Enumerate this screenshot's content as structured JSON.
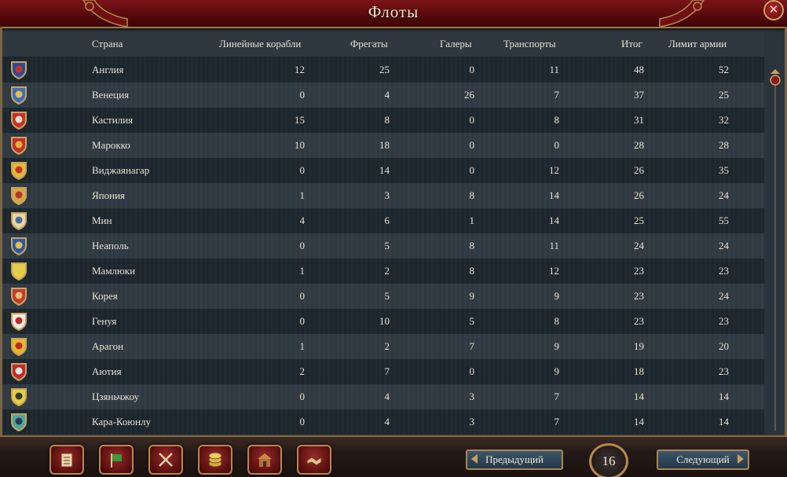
{
  "window": {
    "title": "Флоты",
    "close_icon": "✕"
  },
  "columns": {
    "country": "Страна",
    "ships_of_line": "Линейные корабли",
    "frigates": "Фрегаты",
    "galleys": "Галеры",
    "transports": "Транспорты",
    "total": "Итог",
    "army_limit": "Лимит армии"
  },
  "rows": [
    {
      "country": "Англия",
      "ships": "12",
      "frigates": "25",
      "galleys": "0",
      "transports": "11",
      "total": "48",
      "limit": "52",
      "flag": {
        "field": "#2a4b9a",
        "charge": "#c8302a",
        "accent": "#e6c04a"
      }
    },
    {
      "country": "Венеция",
      "ships": "0",
      "frigates": "4",
      "galleys": "26",
      "transports": "7",
      "total": "37",
      "limit": "25",
      "flag": {
        "field": "#3c6ec0",
        "charge": "#e5c04a",
        "accent": "#e5c04a"
      }
    },
    {
      "country": "Кастилия",
      "ships": "15",
      "frigates": "8",
      "galleys": "0",
      "transports": "8",
      "total": "31",
      "limit": "32",
      "flag": {
        "field": "#c8302a",
        "charge": "#e8e0d0",
        "accent": "#c8302a"
      }
    },
    {
      "country": "Марокко",
      "ships": "10",
      "frigates": "18",
      "galleys": "0",
      "transports": "0",
      "total": "28",
      "limit": "28",
      "flag": {
        "field": "#c0302a",
        "charge": "#e6b040",
        "accent": "#c0302a"
      }
    },
    {
      "country": "Виджаянагар",
      "ships": "0",
      "frigates": "14",
      "galleys": "0",
      "transports": "12",
      "total": "26",
      "limit": "35",
      "flag": {
        "field": "#e2b838",
        "charge": "#c83028",
        "accent": "#e2b838"
      }
    },
    {
      "country": "Япония",
      "ships": "1",
      "frigates": "3",
      "galleys": "8",
      "transports": "14",
      "total": "26",
      "limit": "24",
      "flag": {
        "field": "#d8a648",
        "charge": "#b5352a",
        "accent": "#d8a648"
      }
    },
    {
      "country": "Мин",
      "ships": "4",
      "frigates": "6",
      "galleys": "1",
      "transports": "14",
      "total": "25",
      "limit": "55",
      "flag": {
        "field": "#e6d8a8",
        "charge": "#4a6c9a",
        "accent": "#e6d8a8"
      }
    },
    {
      "country": "Неаполь",
      "ships": "0",
      "frigates": "5",
      "galleys": "8",
      "transports": "11",
      "total": "24",
      "limit": "24",
      "flag": {
        "field": "#2d58a8",
        "charge": "#e2c050",
        "accent": "#2d58a8"
      }
    },
    {
      "country": "Мамлюки",
      "ships": "1",
      "frigates": "2",
      "galleys": "8",
      "transports": "12",
      "total": "23",
      "limit": "23",
      "flag": {
        "field": "#e3cc48",
        "charge": "#e3cc48",
        "accent": "#e3cc48"
      }
    },
    {
      "country": "Корея",
      "ships": "0",
      "frigates": "5",
      "galleys": "9",
      "transports": "9",
      "total": "23",
      "limit": "24",
      "flag": {
        "field": "#c23a30",
        "charge": "#e0c070",
        "accent": "#c23a30"
      }
    },
    {
      "country": "Генуя",
      "ships": "0",
      "frigates": "10",
      "galleys": "5",
      "transports": "8",
      "total": "23",
      "limit": "23",
      "flag": {
        "field": "#ecebe6",
        "charge": "#c42a26",
        "accent": "#ecebe6"
      }
    },
    {
      "country": "Арагон",
      "ships": "1",
      "frigates": "2",
      "galleys": "7",
      "transports": "9",
      "total": "19",
      "limit": "20",
      "flag": {
        "field": "#e8b828",
        "charge": "#c0282a",
        "accent": "#e8b828"
      }
    },
    {
      "country": "Аютия",
      "ships": "2",
      "frigates": "7",
      "galleys": "0",
      "transports": "9",
      "total": "18",
      "limit": "23",
      "flag": {
        "field": "#c02a30",
        "charge": "#eee8e0",
        "accent": "#c02a30"
      }
    },
    {
      "country": "Цзяньчжоу",
      "ships": "0",
      "frigates": "4",
      "galleys": "3",
      "transports": "7",
      "total": "14",
      "limit": "14",
      "flag": {
        "field": "#e6d040",
        "charge": "#3a3a30",
        "accent": "#e6d040"
      }
    },
    {
      "country": "Кара-Коюнлу",
      "ships": "0",
      "frigates": "4",
      "galleys": "3",
      "transports": "7",
      "total": "14",
      "limit": "14",
      "flag": {
        "field": "#4aa8a0",
        "charge": "#2a3a50",
        "accent": "#4aa8a0"
      }
    }
  ],
  "toolbar": {
    "buttons": [
      {
        "name": "ledger-icon"
      },
      {
        "name": "flag-icon"
      },
      {
        "name": "crossed-swords-icon"
      },
      {
        "name": "coins-icon"
      },
      {
        "name": "building-icon"
      },
      {
        "name": "handshake-icon"
      }
    ]
  },
  "pagination": {
    "prev_label": "Предыдущий",
    "next_label": "Следующий",
    "page": "16"
  }
}
